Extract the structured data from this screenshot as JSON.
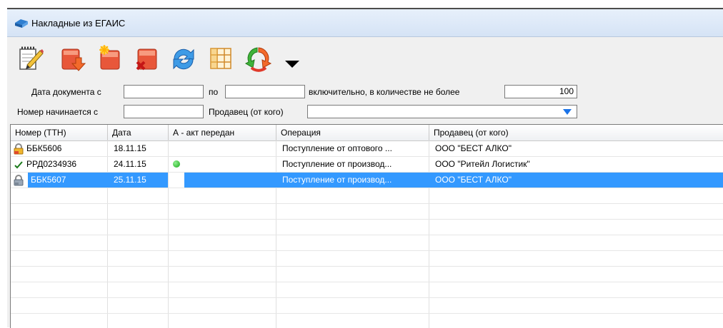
{
  "window": {
    "title": "Накладные из ЕГАИС"
  },
  "toolbar": {
    "buttons": [
      {
        "icon": "edit-notepad-icon"
      },
      {
        "icon": "import-down-icon"
      },
      {
        "icon": "new-document-icon"
      },
      {
        "icon": "delete-document-icon"
      },
      {
        "icon": "refresh-icon"
      },
      {
        "icon": "columns-grid-icon"
      },
      {
        "icon": "send-recycle-icon"
      },
      {
        "icon": "dropdown-arrow-icon"
      }
    ]
  },
  "filters": {
    "date_from_label": "Дата документа с",
    "date_from_value": "",
    "date_to_label": "по",
    "date_to_value": "",
    "limit_label": "включительно, в количестве не более",
    "limit_value": "100",
    "number_label": "Номер начинается с",
    "number_value": "",
    "seller_label": "Продавец (от кого)",
    "seller_value": ""
  },
  "table": {
    "columns": [
      "Номер (ТТН)",
      "Дата",
      "А - акт передан",
      "Операция",
      "Продавец (от кого)"
    ],
    "rows": [
      {
        "icon": "lock-icon",
        "number": "ББК5606",
        "date": "18.11.15",
        "act": "",
        "operation": "Поступление от оптового ...",
        "seller": "ООО \"БЕСТ АЛКО\"",
        "selected": false
      },
      {
        "icon": "check-icon",
        "number": "РРД0234936",
        "date": "24.11.15",
        "act": "green-dot",
        "operation": "Поступление от производ...",
        "seller": "ООО \"Ритейл Логистик\"",
        "selected": false
      },
      {
        "icon": "lock-gray-icon",
        "number": "ББК5607",
        "date": "25.11.15",
        "act": "",
        "operation": "Поступление от производ...",
        "seller": "ООО \"БЕСТ АЛКО\"",
        "selected": true
      }
    ]
  },
  "colors": {
    "selection": "#3399ff",
    "titlebar": "#dce7f6",
    "accent": "#1a73e8"
  }
}
